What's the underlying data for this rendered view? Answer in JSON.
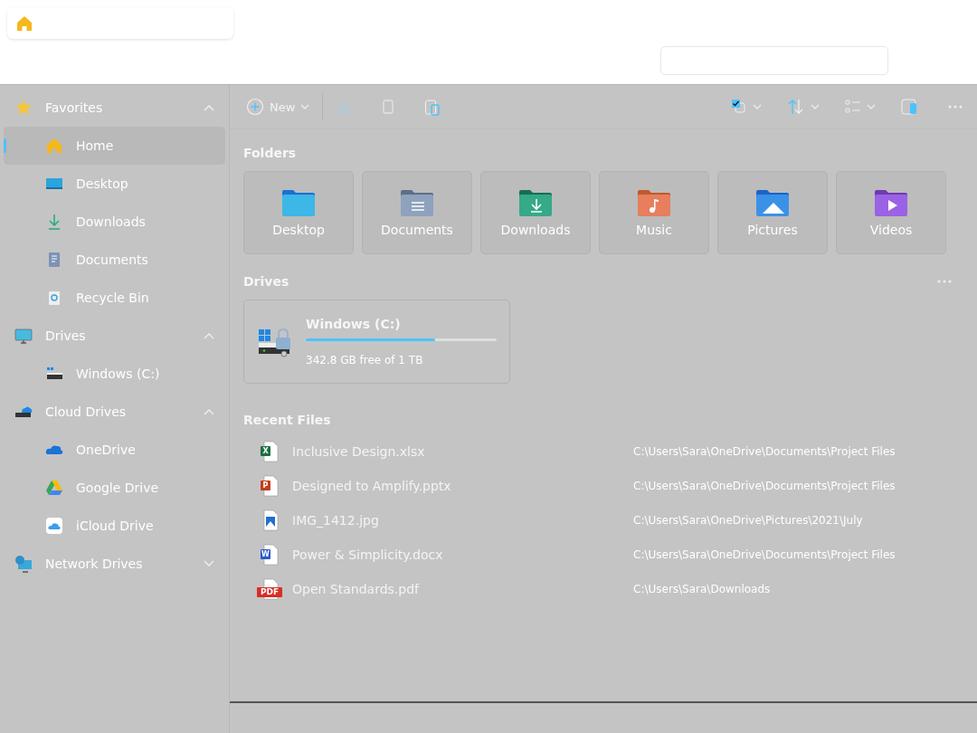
{
  "sidebar": {
    "groups": [
      {
        "label": "Favorites",
        "kind": "star",
        "expanded": true,
        "children": [
          {
            "label": "Home",
            "kind": "home",
            "selected": true
          },
          {
            "label": "Desktop",
            "kind": "desktop",
            "selected": false
          },
          {
            "label": "Downloads",
            "kind": "download",
            "selected": false
          },
          {
            "label": "Documents",
            "kind": "document",
            "selected": false
          },
          {
            "label": "Recycle Bin",
            "kind": "recycle",
            "selected": false
          }
        ]
      },
      {
        "label": "Drives",
        "kind": "monitor",
        "expanded": true,
        "children": [
          {
            "label": "Windows (C:)",
            "kind": "drive",
            "selected": false
          }
        ]
      },
      {
        "label": "Cloud Drives",
        "kind": "clouddrive",
        "expanded": true,
        "children": [
          {
            "label": "OneDrive",
            "kind": "onedrive",
            "selected": false
          },
          {
            "label": "Google Drive",
            "kind": "gdrive",
            "selected": false
          },
          {
            "label": "iCloud Drive",
            "kind": "icloud",
            "selected": false
          }
        ]
      },
      {
        "label": "Network Drives",
        "kind": "network",
        "expanded": false
      }
    ]
  },
  "toolbar": {
    "new_label": "New"
  },
  "folders": {
    "title": "Folders",
    "items": [
      {
        "label": "Desktop",
        "kind": "desktop"
      },
      {
        "label": "Documents",
        "kind": "documents"
      },
      {
        "label": "Downloads",
        "kind": "downloads"
      },
      {
        "label": "Music",
        "kind": "music"
      },
      {
        "label": "Pictures",
        "kind": "pictures"
      },
      {
        "label": "Videos",
        "kind": "videos"
      }
    ]
  },
  "drives": {
    "title": "Drives",
    "items": [
      {
        "name": "Windows (C:)",
        "level": 0.68,
        "free": "342.8 GB free of 1 TB"
      }
    ]
  },
  "recent": {
    "title": "Recent Files",
    "items": [
      {
        "name": "Inclusive Design.xlsx",
        "kind": "xlsx",
        "badge": "X",
        "path": "C:\\Users\\Sara\\OneDrive\\Documents\\Project Files"
      },
      {
        "name": "Designed to Amplify.pptx",
        "kind": "pptx",
        "badge": "P",
        "path": "C:\\Users\\Sara\\OneDrive\\Documents\\Project Files"
      },
      {
        "name": "IMG_1412.jpg",
        "kind": "jpg",
        "path": "C:\\Users\\Sara\\OneDrive\\Pictures\\2021\\July"
      },
      {
        "name": "Power & Simplicity.docx",
        "kind": "docx",
        "badge": "W",
        "path": "C:\\Users\\Sara\\OneDrive\\Documents\\Project Files"
      },
      {
        "name": "Open Standards.pdf",
        "kind": "pdf",
        "badge": "PDF",
        "path": "C:\\Users\\Sara\\Downloads"
      }
    ]
  }
}
